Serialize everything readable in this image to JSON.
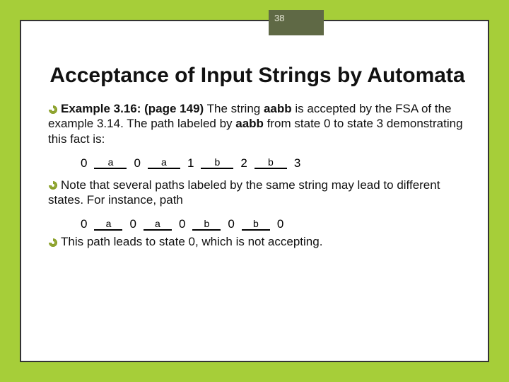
{
  "page_number": "38",
  "title": "Acceptance of Input Strings by Automata",
  "para1": {
    "lead": "Example 3.16: (page 149)",
    "mid1": " The string ",
    "str1": "aabb",
    "mid2": " is accepted by the FSA of the example 3.14. The path labeled by ",
    "str2": "aabb",
    "tail": " from state 0 to state 3 demonstrating this fact is:"
  },
  "path1": {
    "n0": "0",
    "e0": "a",
    "n1": "0",
    "e1": "a",
    "n2": "1",
    "e2": "b",
    "n3": "2",
    "e3": "b",
    "n4": "3"
  },
  "para2": "Note that several paths labeled by the same string may lead to different states. For instance, path",
  "path2": {
    "n0": "0",
    "e0": "a",
    "n1": "0",
    "e1": "a",
    "n2": "0",
    "e2": "b",
    "n3": "0",
    "e3": "b",
    "n4": "0"
  },
  "para3": "This path leads to state 0, which is not accepting."
}
